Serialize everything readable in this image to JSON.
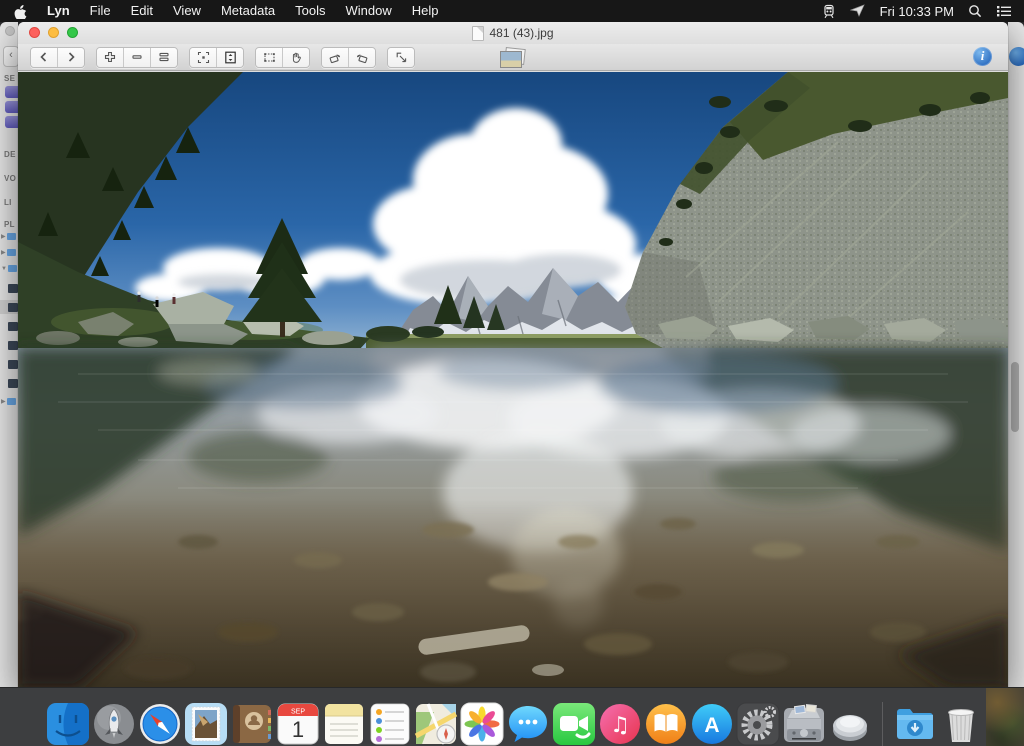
{
  "menubar": {
    "items": [
      "Lyn",
      "File",
      "Edit",
      "View",
      "Metadata",
      "Tools",
      "Window",
      "Help"
    ],
    "clock": "Fri 10:33 PM",
    "icons": [
      "apple-icon",
      "transit-status-icon",
      "pointer-status-icon",
      "spotlight-search-icon",
      "notification-center-icon"
    ]
  },
  "window": {
    "title": "481 (43).jpg",
    "info_glyph": "i",
    "toolbar_icons": [
      "back",
      "forward",
      "zoom-in",
      "zoom-out",
      "actual-size",
      "zoom-to-fit",
      "fit-vertical",
      "selection",
      "hand-pan",
      "rotate-left",
      "rotate-right",
      "fullscreen",
      "browser-thumbnail",
      "info"
    ]
  },
  "sidebar": {
    "labels": [
      "SE",
      "DE",
      "VO",
      "LI",
      "PL"
    ]
  },
  "photo": {
    "alt": "Alpine lake mirroring large white cumulus clouds, dark green forested slope on the left, gray scree slope on the right, snow-streaked mountain range on the horizon under a deep blue sky, clear stony shallows in the foreground"
  },
  "dock": {
    "items": [
      "finder",
      "launchpad",
      "safari",
      "mail",
      "contacts",
      "calendar",
      "notes",
      "reminders",
      "maps",
      "photos",
      "messages",
      "facetime",
      "itunes",
      "ibooks",
      "app-store",
      "system-preferences",
      "scanner-app",
      "round-app",
      "downloads",
      "trash"
    ],
    "calendar": {
      "month": "SEP",
      "day": "1"
    },
    "glyphs": {
      "itunes": "♫",
      "app_store": "A"
    }
  },
  "colors": {
    "accent_blue": "#2e6fc2",
    "menubar_bg": "#171717",
    "dock_bg": "#3d3e40",
    "sky_blue": "#2a66a8"
  }
}
